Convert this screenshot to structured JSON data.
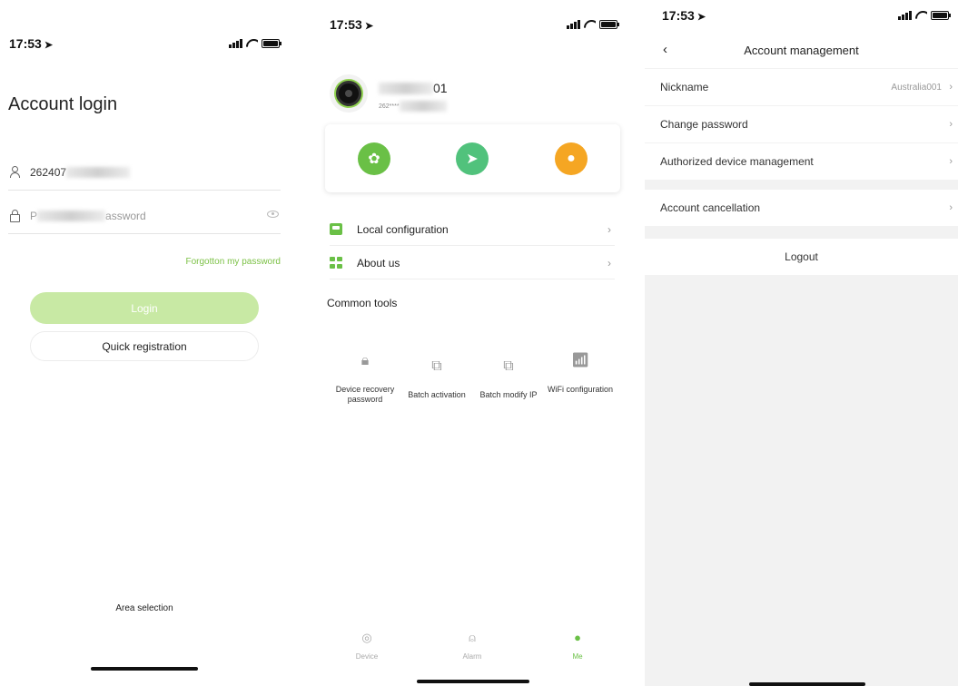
{
  "login": {
    "status_time": "17:53",
    "title": "Account login",
    "username_value": "262407",
    "password_placeholder_start": "P",
    "password_placeholder_end": "assword",
    "forgot_link": "Forgotton my password",
    "login_button": "Login",
    "register_button": "Quick registration",
    "area_selection": "Area selection"
  },
  "me": {
    "status_time": "17:53",
    "user_name_suffix": "01",
    "user_id_prefix": "262****",
    "quick_icons": [
      "aperture-icon",
      "send-icon",
      "user-icon"
    ],
    "menu": [
      {
        "label": "Local configuration",
        "icon": "inbox-icon"
      },
      {
        "label": "About us",
        "icon": "grid-icon"
      }
    ],
    "common_tools_title": "Common tools",
    "tools": [
      {
        "label": "Device recovery password",
        "icon": "lock-icon"
      },
      {
        "label": "Batch activation",
        "icon": "copy-icon"
      },
      {
        "label": "Batch modify IP",
        "icon": "edit-copy-icon"
      },
      {
        "label": "WiFi configuration",
        "icon": "wifi-icon"
      }
    ],
    "tabs": [
      {
        "label": "Device",
        "icon": "camera-icon"
      },
      {
        "label": "Alarm",
        "icon": "alarm-icon"
      },
      {
        "label": "Me",
        "icon": "person-icon"
      }
    ],
    "accent_color": "#6ac046"
  },
  "account": {
    "status_time": "17:53",
    "title": "Account management",
    "rows": [
      {
        "label": "Nickname",
        "value": "Australia001"
      },
      {
        "label": "Change password",
        "value": ""
      },
      {
        "label": "Authorized device management",
        "value": ""
      },
      {
        "label": "Account cancellation",
        "value": ""
      }
    ],
    "logout": "Logout"
  }
}
